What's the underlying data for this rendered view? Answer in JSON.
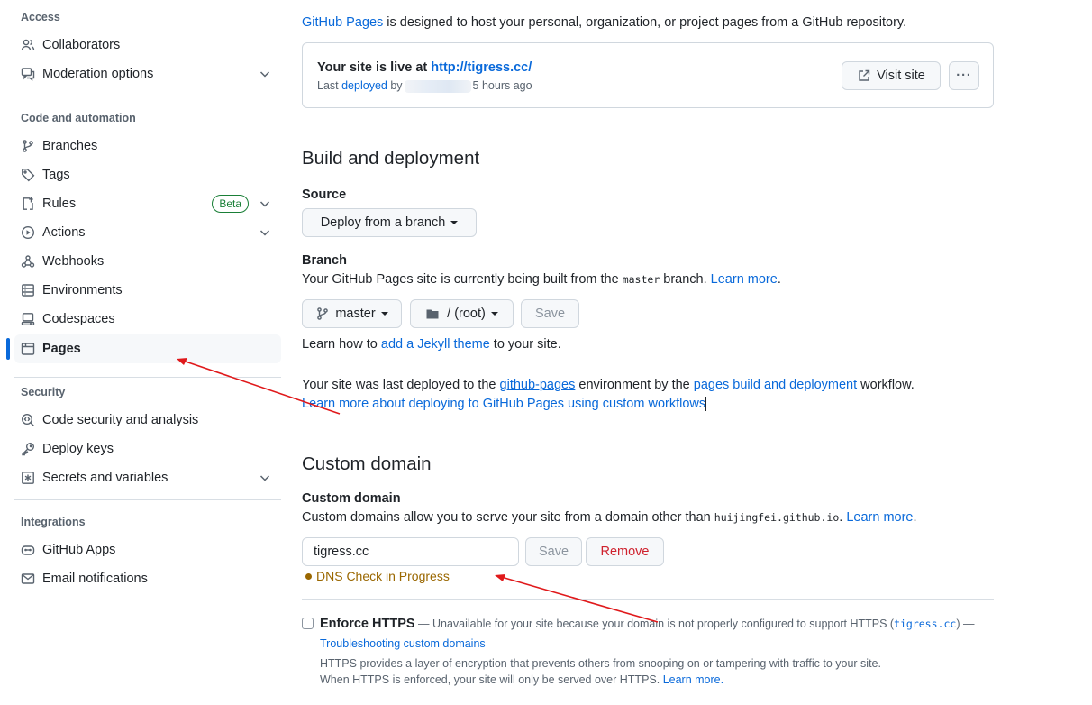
{
  "sidebar": {
    "sections": {
      "access": "Access",
      "code_automation": "Code and automation",
      "security": "Security",
      "integrations": "Integrations"
    },
    "items": {
      "collaborators": "Collaborators",
      "moderation": "Moderation options",
      "branches": "Branches",
      "tags": "Tags",
      "rules": "Rules",
      "rules_badge": "Beta",
      "actions": "Actions",
      "webhooks": "Webhooks",
      "environments": "Environments",
      "codespaces": "Codespaces",
      "pages": "Pages",
      "code_security": "Code security and analysis",
      "deploy_keys": "Deploy keys",
      "secrets": "Secrets and variables",
      "github_apps": "GitHub Apps",
      "email_notifications": "Email notifications"
    }
  },
  "intro": {
    "link": "GitHub Pages",
    "text": " is designed to host your personal, organization, or project pages from a GitHub repository."
  },
  "live": {
    "title_prefix": "Your site is live at ",
    "url": "http://tigress.cc/",
    "sub_prefix": "Last ",
    "sub_link": "deployed",
    "sub_by": " by",
    "sub_time": "5 hours ago",
    "visit_label": "Visit site",
    "more_label": "···"
  },
  "build": {
    "heading": "Build and deployment",
    "source_label": "Source",
    "source_value": "Deploy from a branch",
    "branch_label": "Branch",
    "branch_text_1": "Your GitHub Pages site is currently being built from the ",
    "branch_code": "master",
    "branch_text_2": " branch. ",
    "branch_learn": "Learn more",
    "branch_period": ".",
    "branch_button": "master",
    "folder_button": "/ (root)",
    "save_label": "Save",
    "jekyll_prefix": "Learn how to ",
    "jekyll_link": "add a Jekyll theme",
    "jekyll_suffix": " to your site.",
    "deploy_text_1": "Your site was last deployed to the ",
    "deploy_env": "github-pages",
    "deploy_text_2": " environment by the ",
    "deploy_workflow": "pages build and deployment",
    "deploy_text_3": " workflow.",
    "deploy_learn": "Learn more about deploying to GitHub Pages using custom workflows"
  },
  "custom": {
    "heading": "Custom domain",
    "label": "Custom domain",
    "desc_1": "Custom domains allow you to serve your site from a domain other than ",
    "desc_code": "huijingfei.github.io",
    "desc_2": ". ",
    "desc_learn": "Learn more",
    "desc_period": ".",
    "input_value": "tigress.cc",
    "save_label": "Save",
    "remove_label": "Remove",
    "dns_status": "DNS Check in Progress"
  },
  "https": {
    "label": "Enforce HTTPS",
    "note_1": " — Unavailable for your site because your domain is not properly configured to support HTTPS (",
    "note_code": "tigress.cc",
    "note_2": ") —",
    "troubleshoot": "Troubleshooting custom domains",
    "desc_1": "HTTPS provides a layer of encryption that prevents others from snooping on or tampering with traffic to your site.",
    "desc_2": "When HTTPS is enforced, your site will only be served over HTTPS. ",
    "desc_learn": "Learn more."
  },
  "colors": {
    "accent": "#0969da",
    "success": "#1a7f37",
    "danger": "#cf222e",
    "attention": "#9a6700",
    "annotation_arrow": "#e0191b"
  }
}
